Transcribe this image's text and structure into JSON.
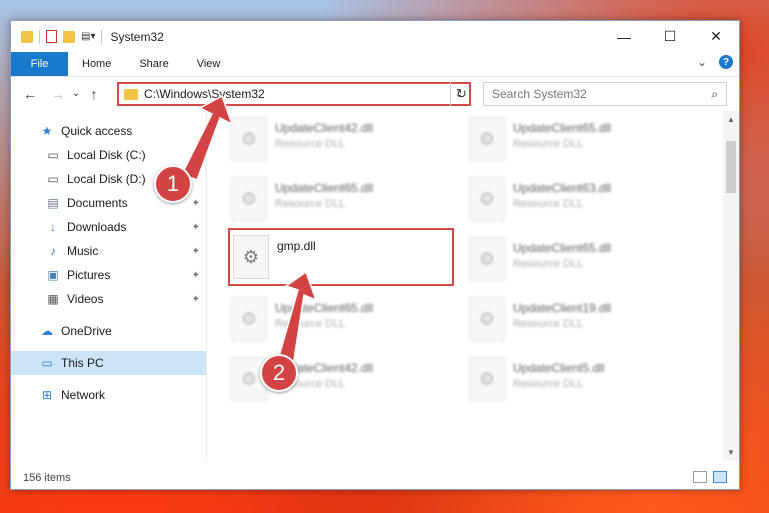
{
  "window": {
    "title": "System32",
    "buttons": {
      "minimize": "—",
      "maximize": "☐",
      "close": "✕"
    }
  },
  "ribbon": {
    "tabs": [
      "File",
      "Home",
      "Share",
      "View"
    ],
    "expand": "⌄",
    "help": "?"
  },
  "nav": {
    "back": "←",
    "forward": "→",
    "recent": "⌄",
    "up": "↑",
    "address": "C:\\Windows\\System32",
    "address_dropdown": "⌄",
    "refresh": "↻",
    "search_placeholder": "Search System32",
    "search_icon": "⌕"
  },
  "sidebar": {
    "items": [
      {
        "label": "Quick access",
        "icon": "star-icon",
        "glyph": "★",
        "pinned": false
      },
      {
        "label": "Local Disk (C:)",
        "icon": "drive-icon",
        "glyph": "▭",
        "pinned": true
      },
      {
        "label": "Local Disk (D:)",
        "icon": "drive-icon",
        "glyph": "▭",
        "pinned": true
      },
      {
        "label": "Documents",
        "icon": "documents-icon",
        "glyph": "▤",
        "pinned": true
      },
      {
        "label": "Downloads",
        "icon": "downloads-icon",
        "glyph": "↓",
        "pinned": true
      },
      {
        "label": "Music",
        "icon": "music-icon",
        "glyph": "♪",
        "pinned": true
      },
      {
        "label": "Pictures",
        "icon": "pictures-icon",
        "glyph": "▣",
        "pinned": true
      },
      {
        "label": "Videos",
        "icon": "videos-icon",
        "glyph": "▦",
        "pinned": true
      },
      {
        "label": "OneDrive",
        "icon": "cloud-icon",
        "glyph": "☁",
        "pinned": false
      },
      {
        "label": "This PC",
        "icon": "computer-icon",
        "glyph": "▭",
        "pinned": false
      },
      {
        "label": "Network",
        "icon": "network-icon",
        "glyph": "⊞",
        "pinned": false
      }
    ],
    "pin_glyph": "✦"
  },
  "files": [
    {
      "name": "UpdateClient42.dll",
      "type": "Resource DLL"
    },
    {
      "name": "UpdateClient65.dll",
      "type": "Resource DLL"
    },
    {
      "name": "UpdateClient65.dll",
      "type": "Resource DLL"
    },
    {
      "name": "UpdateClient63.dll",
      "type": "Resource DLL"
    },
    {
      "name": "gmp.dll",
      "type": ""
    },
    {
      "name": "UpdateClient65.dll",
      "type": "Resource DLL"
    },
    {
      "name": "UpdateClient65.dll",
      "type": "Resource DLL"
    },
    {
      "name": "UpdateClient19.dll",
      "type": "Resource DLL"
    },
    {
      "name": "UpdateClient42.dll",
      "type": "Resource DLL"
    },
    {
      "name": "UpdateClient5.dll",
      "type": "Resource DLL"
    }
  ],
  "file_icon_glyph": "⚙",
  "status": {
    "count": "156 items"
  },
  "annotations": {
    "step1": "1",
    "step2": "2"
  },
  "colors": {
    "accent": "#1979ca",
    "annotation": "#d44343",
    "selected": "#cce4f7"
  }
}
